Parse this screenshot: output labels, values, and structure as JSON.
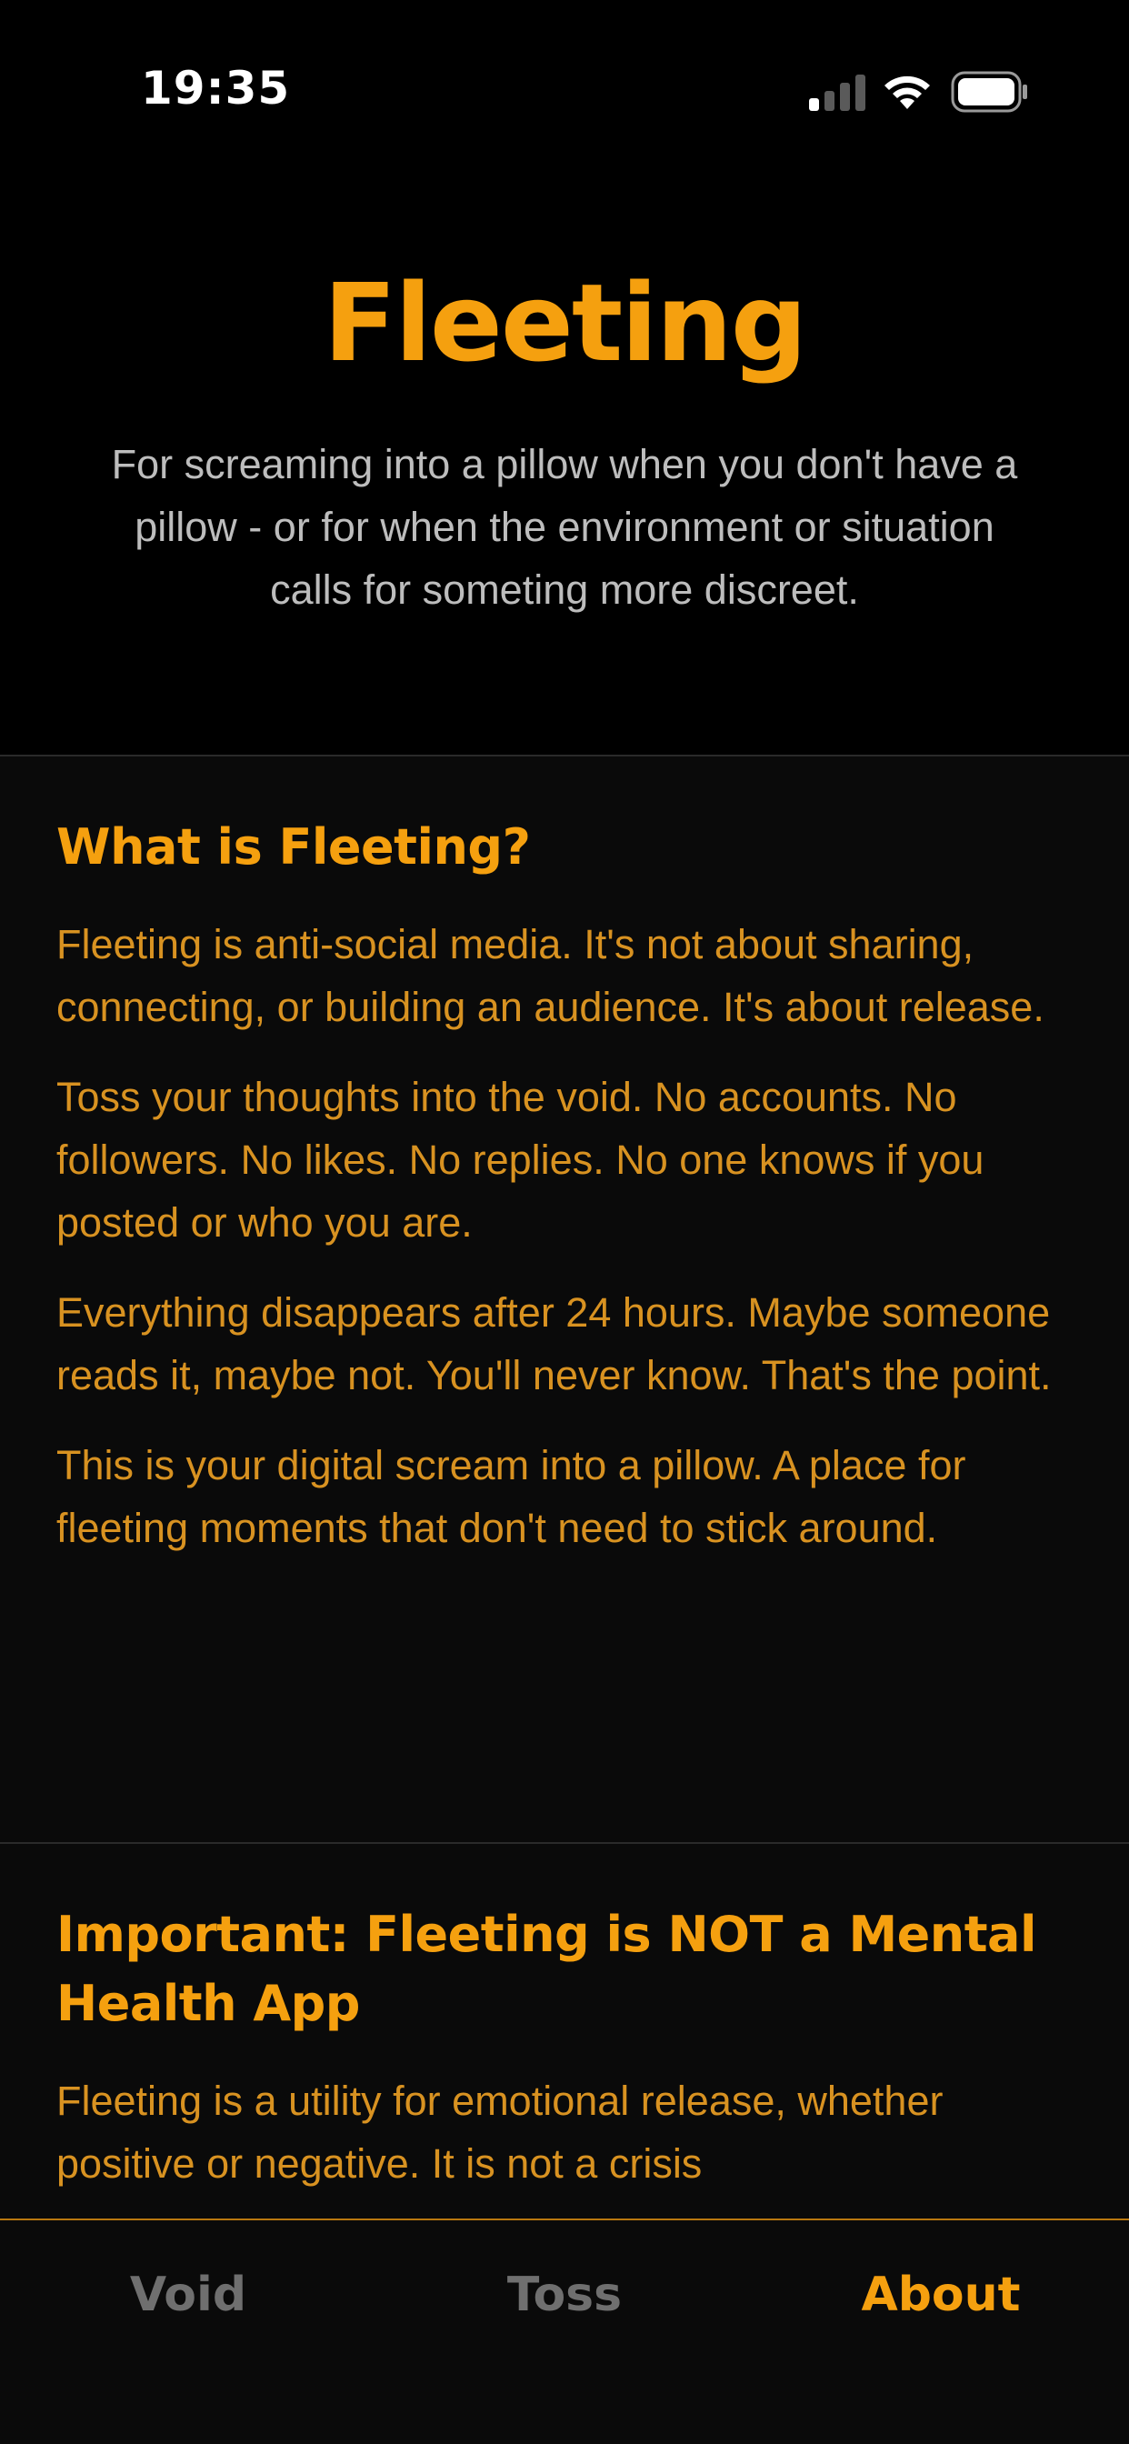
{
  "status_bar": {
    "time": "19:35",
    "icons": [
      "cellular-signal-icon",
      "wifi-icon",
      "battery-icon"
    ]
  },
  "header": {
    "title": "Fleeting",
    "tagline": "For screaming into a pillow when you don't have a pillow - or for when the environment or situation calls for someting more discreet."
  },
  "sections": [
    {
      "heading": "What is Fleeting?",
      "paragraphs": [
        "Fleeting is anti-social media. It's not about sharing, connecting, or building an audience. It's about release.",
        "Toss your thoughts into the void. No accounts. No followers. No likes. No replies. No one knows if you posted or who you are.",
        "Everything disappears after 24 hours. Maybe someone reads it, maybe not. You'll never know. That's the point.",
        "This is your digital scream into a pillow. A place for fleeting moments that don't need to stick around."
      ]
    },
    {
      "heading": "Important: Fleeting is NOT a Mental Health App",
      "paragraphs": [
        "Fleeting is a utility for emotional release, whether positive or negative. It is not a crisis"
      ]
    }
  ],
  "tab_bar": {
    "tabs": [
      {
        "label": "Void",
        "active": false
      },
      {
        "label": "Toss",
        "active": false
      },
      {
        "label": "About",
        "active": true
      }
    ]
  },
  "colors": {
    "accent": "#F5A00F",
    "body_text": "#D89221",
    "background": "#000000",
    "inactive_tab": "#6f6f6f"
  }
}
